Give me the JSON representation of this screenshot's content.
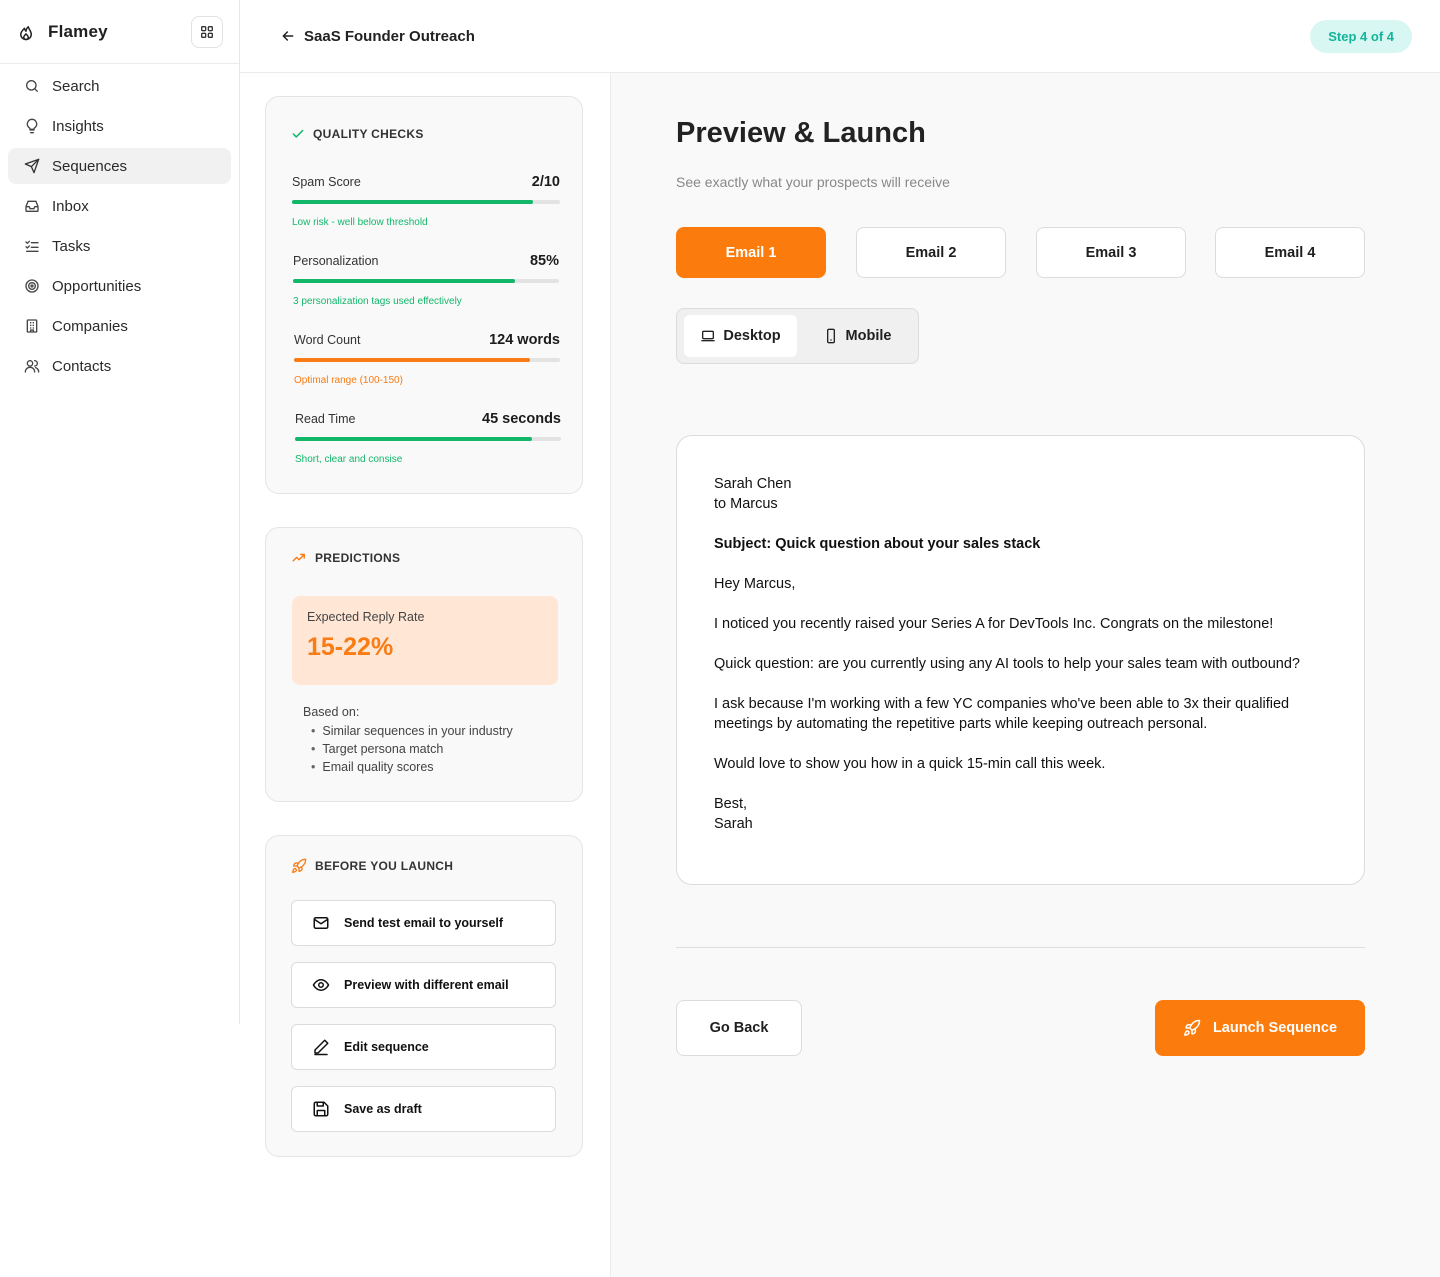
{
  "app": {
    "name": "Flamey"
  },
  "sidebar": {
    "items": [
      {
        "label": "Search",
        "icon": "search-icon"
      },
      {
        "label": "Insights",
        "icon": "lightbulb-icon"
      },
      {
        "label": "Sequences",
        "icon": "send-icon",
        "active": true
      },
      {
        "label": "Inbox",
        "icon": "inbox-icon"
      },
      {
        "label": "Tasks",
        "icon": "tasks-icon"
      },
      {
        "label": "Opportunities",
        "icon": "target-icon"
      },
      {
        "label": "Companies",
        "icon": "building-icon"
      },
      {
        "label": "Contacts",
        "icon": "users-icon"
      }
    ]
  },
  "header": {
    "title": "SaaS Founder Outreach",
    "step": "Step 4 of 4"
  },
  "colors": {
    "accent": "#fb7c0c",
    "success": "#12b76a",
    "teal": "#14b49a"
  },
  "quality": {
    "title": "QUALITY CHECKS",
    "metrics": [
      {
        "label": "Spam Score",
        "value": "2/10",
        "progress": 0.9,
        "note": "Low risk - well below threshold",
        "color": "#12b76a"
      },
      {
        "label": "Personalization",
        "value": "85%",
        "progress": 0.833,
        "note": "3 personalization tags used effectively",
        "color": "#12b76a"
      },
      {
        "label": "Word Count",
        "value": "124 words",
        "progress": 0.888,
        "note": "Optimal range (100-150)",
        "color": "#f97c14"
      },
      {
        "label": "Read Time",
        "value": "45 seconds",
        "progress": 0.891,
        "note": "Short, clear and consise",
        "color": "#12b76a"
      }
    ]
  },
  "predictions": {
    "title": "PREDICTIONS",
    "reply_label": "Expected Reply Rate",
    "reply_value": "15-22%",
    "based_on_label": "Based on:",
    "factors": [
      "Similar sequences in your industry",
      "Target persona match",
      "Email quality scores"
    ]
  },
  "launch_prep": {
    "title": "BEFORE YOU LAUNCH",
    "actions": [
      {
        "label": "Send test email to yourself",
        "icon": "mail-icon"
      },
      {
        "label": "Preview with different email",
        "icon": "eye-icon"
      },
      {
        "label": "Edit sequence",
        "icon": "pencil-icon"
      },
      {
        "label": "Save as draft",
        "icon": "save-icon"
      }
    ]
  },
  "main": {
    "title": "Preview & Launch",
    "subtitle": "See exactly what your prospects will receive",
    "email_tabs": [
      "Email 1",
      "Email 2",
      "Email 3",
      "Email 4"
    ],
    "view_toggle": {
      "desktop": "Desktop",
      "mobile": "Mobile",
      "selected": "Desktop"
    },
    "email": {
      "from": "Sarah Chen",
      "to": "to Marcus",
      "subject": "Subject: Quick question about your sales stack",
      "greeting": "Hey Marcus,",
      "p1": "I noticed you recently raised your Series A for DevTools Inc. Congrats on the milestone!",
      "p2": "Quick question: are you currently using any AI tools to help your sales team with outbound?",
      "p3": "I ask because I'm working with a few YC companies who've been able to 3x their qualified meetings by automating the repetitive parts while keeping outreach personal.",
      "p4": "Would love to show you how in a quick 15-min call this week.",
      "signoff": "Best,",
      "signature": "Sarah"
    },
    "go_back": "Go Back",
    "launch": "Launch Sequence"
  }
}
